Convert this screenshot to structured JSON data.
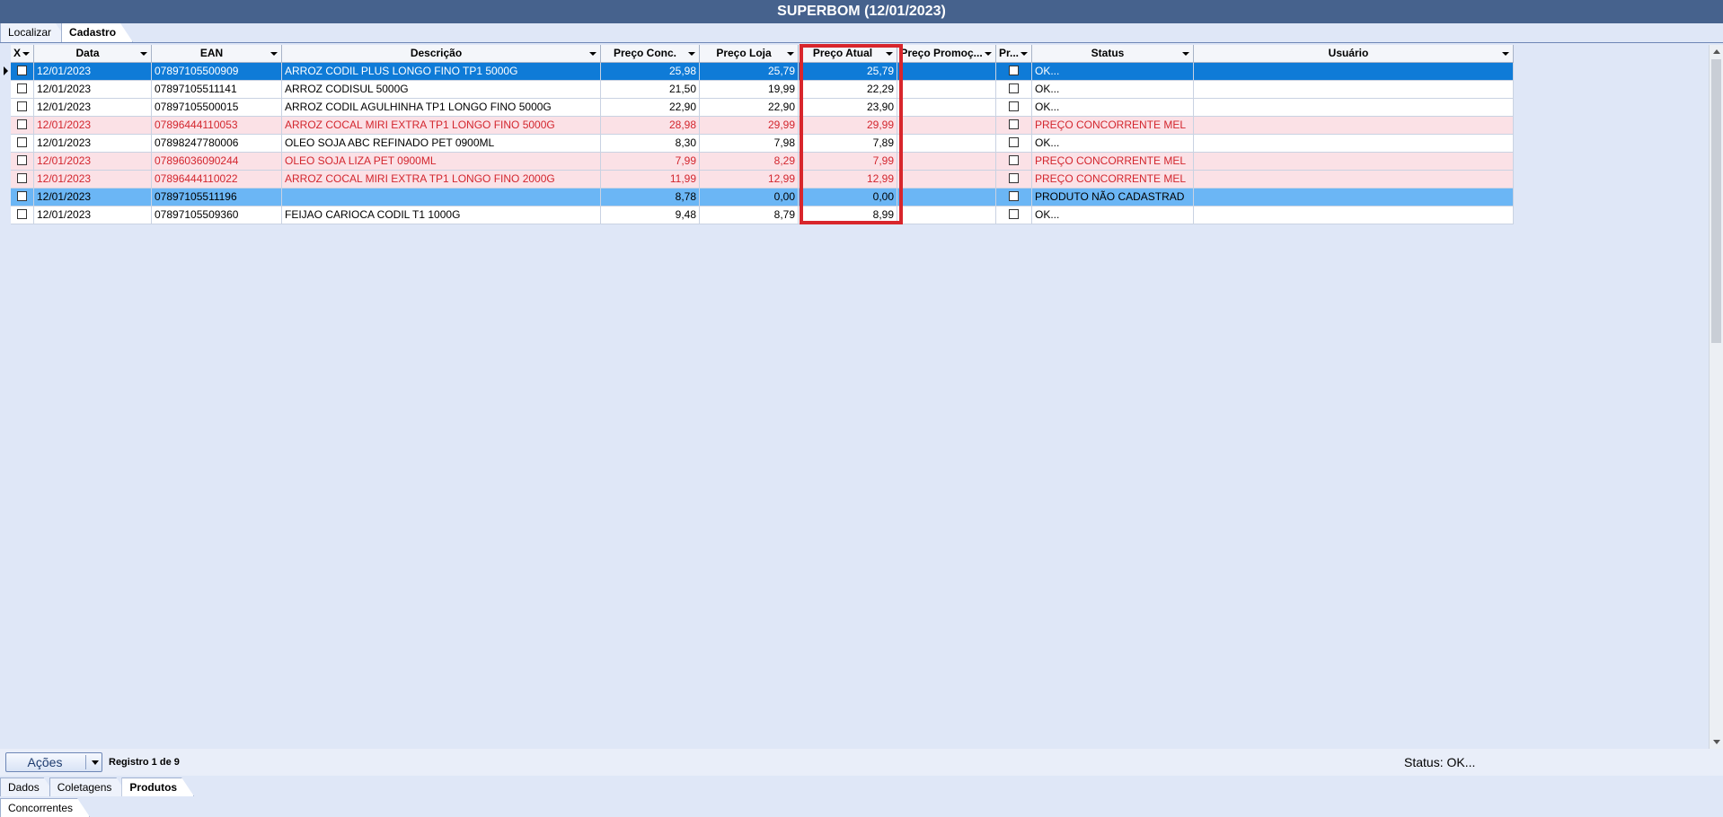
{
  "window": {
    "title": "SUPERBOM (12/01/2023)"
  },
  "top_tabs": [
    {
      "label": "Localizar",
      "active": false
    },
    {
      "label": "Cadastro",
      "active": true
    }
  ],
  "grid": {
    "columns": {
      "x": "X",
      "data": "Data",
      "ean": "EAN",
      "descricao": "Descrição",
      "preco_conc": "Preço Conc.",
      "preco_loja": "Preço Loja",
      "preco_atual": "Preço Atual",
      "preco_promoc": "Preço Promoç...",
      "pr": "Pr...",
      "status": "Status",
      "usuario": "Usuário"
    },
    "rows": [
      {
        "data": "12/01/2023",
        "ean": "07897105500909",
        "descricao": "ARROZ CODIL PLUS LONGO FINO TP1 5000G",
        "preco_conc": "25,98",
        "preco_loja": "25,79",
        "preco_atual": "25,79",
        "preco_promoc": "",
        "status": "OK...",
        "usuario": ""
      },
      {
        "data": "12/01/2023",
        "ean": "07897105511141",
        "descricao": "ARROZ CODISUL 5000G",
        "preco_conc": "21,50",
        "preco_loja": "19,99",
        "preco_atual": "22,29",
        "preco_promoc": "",
        "status": "OK...",
        "usuario": ""
      },
      {
        "data": "12/01/2023",
        "ean": "07897105500015",
        "descricao": "ARROZ CODIL AGULHINHA TP1 LONGO FINO 5000G",
        "preco_conc": "22,90",
        "preco_loja": "22,90",
        "preco_atual": "23,90",
        "preco_promoc": "",
        "status": "OK...",
        "usuario": ""
      },
      {
        "data": "12/01/2023",
        "ean": "07896444110053",
        "descricao": "ARROZ COCAL MIRI EXTRA TP1 LONGO FINO 5000G",
        "preco_conc": "28,98",
        "preco_loja": "29,99",
        "preco_atual": "29,99",
        "preco_promoc": "",
        "status": "PREÇO CONCORRENTE MEL",
        "usuario": ""
      },
      {
        "data": "12/01/2023",
        "ean": "07898247780006",
        "descricao": "OLEO SOJA ABC REFINADO PET 0900ML",
        "preco_conc": "8,30",
        "preco_loja": "7,98",
        "preco_atual": "7,89",
        "preco_promoc": "",
        "status": "OK...",
        "usuario": ""
      },
      {
        "data": "12/01/2023",
        "ean": "07896036090244",
        "descricao": "OLEO SOJA LIZA PET 0900ML",
        "preco_conc": "7,99",
        "preco_loja": "8,29",
        "preco_atual": "7,99",
        "preco_promoc": "",
        "status": "PREÇO CONCORRENTE MEL",
        "usuario": ""
      },
      {
        "data": "12/01/2023",
        "ean": "07896444110022",
        "descricao": "ARROZ COCAL MIRI EXTRA TP1 LONGO FINO 2000G",
        "preco_conc": "11,99",
        "preco_loja": "12,99",
        "preco_atual": "12,99",
        "preco_promoc": "",
        "status": "PREÇO CONCORRENTE MEL",
        "usuario": ""
      },
      {
        "data": "12/01/2023",
        "ean": "07897105511196",
        "descricao": "",
        "preco_conc": "8,78",
        "preco_loja": "0,00",
        "preco_atual": "0,00",
        "preco_promoc": "",
        "status": "PRODUTO NÃO CADASTRAD",
        "usuario": ""
      },
      {
        "data": "12/01/2023",
        "ean": "07897105509360",
        "descricao": "FEIJAO CARIOCA CODIL T1 1000G",
        "preco_conc": "9,48",
        "preco_loja": "8,79",
        "preco_atual": "8,99",
        "preco_promoc": "",
        "status": "OK...",
        "usuario": ""
      }
    ]
  },
  "footer": {
    "actions_label": "Ações",
    "record_text": "Registro 1 de 9",
    "status_text": "Status: OK..."
  },
  "sub_tabs": [
    {
      "label": "Dados",
      "active": false
    },
    {
      "label": "Coletagens",
      "active": false
    },
    {
      "label": "Produtos",
      "active": true
    }
  ],
  "bottom_tabs": [
    {
      "label": "Concorrentes",
      "active": true
    }
  ],
  "colors": {
    "title_bar": "#46628d",
    "selected_row": "#0f7bd7",
    "secondary_selected_row": "#6bb6f5",
    "alert_row_bg": "#fbe1e6",
    "alert_text": "#d3262e",
    "highlight_box": "#d8262c"
  }
}
